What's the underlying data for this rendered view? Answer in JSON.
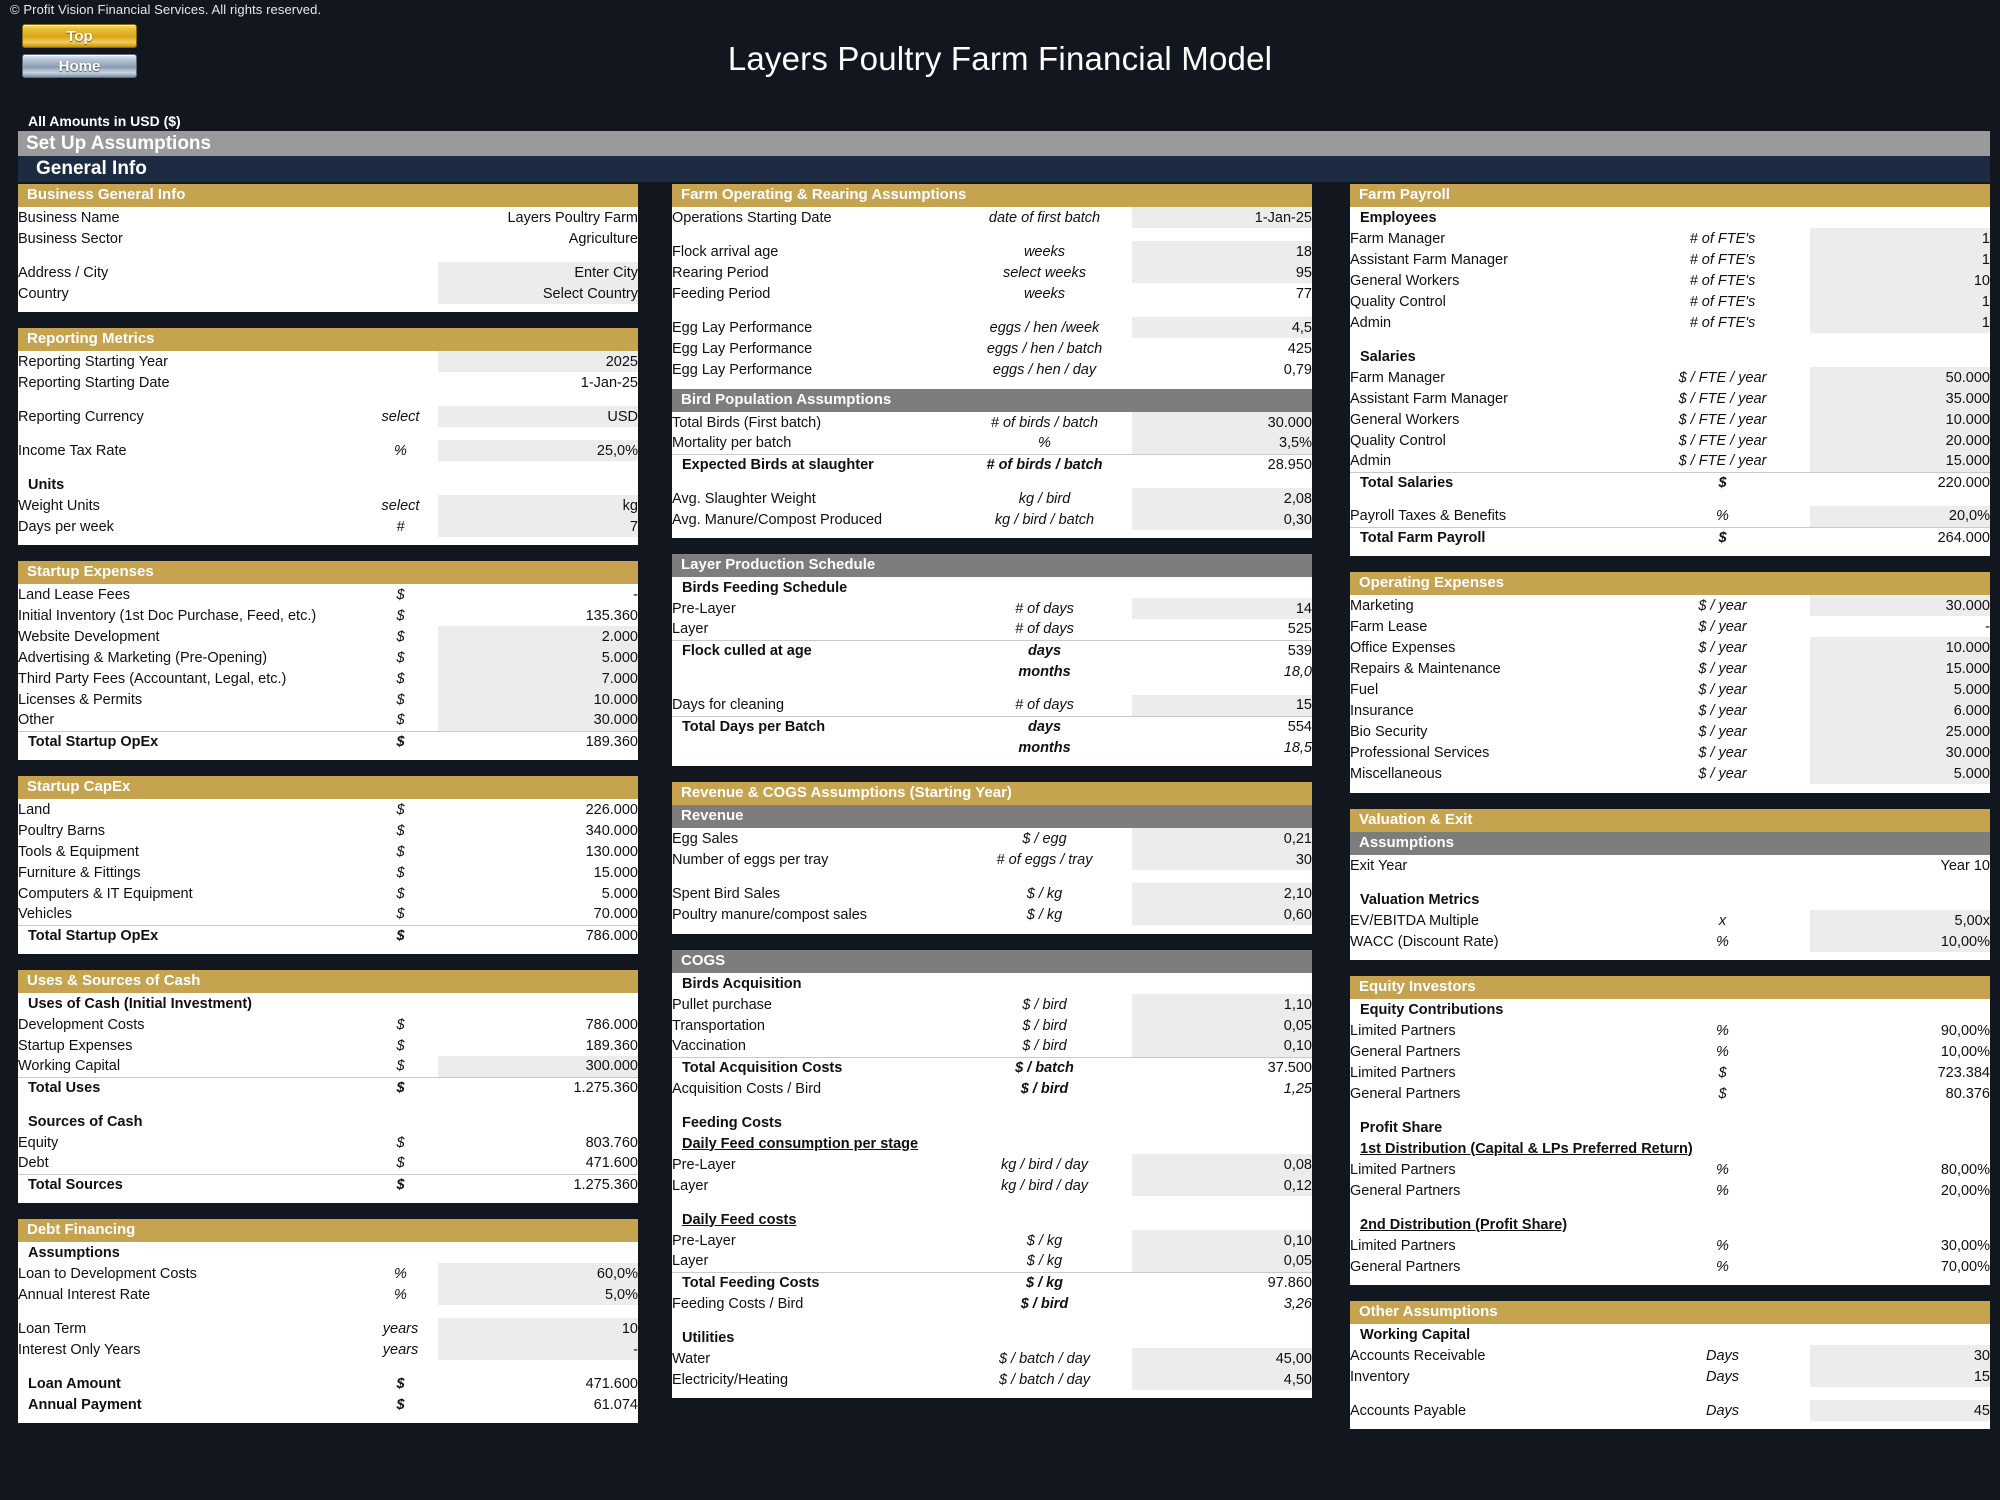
{
  "header": {
    "copyright": "© Profit Vision Financial Services. All rights reserved.",
    "top_button": "Top",
    "home_button": "Home",
    "title": "Layers Poultry Farm Financial Model",
    "amounts_note": "All Amounts in  USD ($)",
    "setup_bar": "Set Up Assumptions",
    "general_bar": "General Info"
  },
  "colors": {
    "gold": "#C6A44F",
    "grey_header": "#7D7D7D",
    "navy": "#1D2B42",
    "input_blue": "#1A2F9E",
    "green": "#1A7A4A",
    "teal": "#1F7F8C"
  },
  "business_general_info": {
    "title": "Business General Info",
    "rows": [
      {
        "label": "Business Name",
        "unit": "",
        "value": "Layers Poultry Farm",
        "style": "cal"
      },
      {
        "label": "Business Sector",
        "unit": "",
        "value": "Agriculture",
        "style": "cal"
      },
      {
        "label": "Address / City",
        "unit": "",
        "value": "Enter City",
        "style": "in"
      },
      {
        "label": "Country",
        "unit": "",
        "value": "Select Country",
        "style": "in"
      }
    ]
  },
  "reporting_metrics": {
    "title": "Reporting Metrics",
    "rows": [
      {
        "label": "Reporting Starting Year",
        "unit": "",
        "value": "2025",
        "style": "in"
      },
      {
        "label": "Reporting Starting Date",
        "unit": "",
        "value": "1-Jan-25",
        "style": "cal"
      },
      {
        "label": "Reporting Currency",
        "unit": "select",
        "value": "USD",
        "style": "in"
      },
      {
        "label": "Income Tax Rate",
        "unit": "%",
        "value": "25,0%",
        "style": "in"
      }
    ],
    "units_title": "Units",
    "units_rows": [
      {
        "label": "Weight Units",
        "unit": "select",
        "value": "kg",
        "style": "in"
      },
      {
        "label": "Days per week",
        "unit": "#",
        "value": "7",
        "style": "in"
      }
    ]
  },
  "startup_expenses": {
    "title": "Startup Expenses",
    "rows": [
      {
        "label": "Land Lease Fees",
        "unit": "$",
        "value": "-",
        "style": "cal"
      },
      {
        "label": "Initial Inventory (1st Doc Purchase, Feed, etc.)",
        "unit": "$",
        "value": "135.360",
        "style": "cal"
      },
      {
        "label": "Website Development",
        "unit": "$",
        "value": "2.000",
        "style": "in"
      },
      {
        "label": "Advertising & Marketing (Pre-Opening)",
        "unit": "$",
        "value": "5.000",
        "style": "in"
      },
      {
        "label": "Third Party Fees (Accountant, Legal, etc.)",
        "unit": "$",
        "value": "7.000",
        "style": "in"
      },
      {
        "label": "Licenses & Permits",
        "unit": "$",
        "value": "10.000",
        "style": "in"
      },
      {
        "label": "Other",
        "unit": "$",
        "value": "30.000",
        "style": "in"
      }
    ],
    "total": {
      "label": "Total Startup OpEx",
      "unit": "$",
      "value": "189.360"
    }
  },
  "startup_capex": {
    "title": "Startup CapEx",
    "rows": [
      {
        "label": "Land",
        "unit": "$",
        "value": "226.000",
        "style": "grn"
      },
      {
        "label": "Poultry Barns",
        "unit": "$",
        "value": "340.000",
        "style": "grn"
      },
      {
        "label": "Tools & Equipment",
        "unit": "$",
        "value": "130.000",
        "style": "grn"
      },
      {
        "label": "Furniture & Fittings",
        "unit": "$",
        "value": "15.000",
        "style": "grn"
      },
      {
        "label": "Computers & IT Equipment",
        "unit": "$",
        "value": "5.000",
        "style": "grn"
      },
      {
        "label": "Vehicles",
        "unit": "$",
        "value": "70.000",
        "style": "grn"
      }
    ],
    "total": {
      "label": "Total Startup OpEx",
      "unit": "$",
      "value": "786.000"
    }
  },
  "uses_sources": {
    "title": "Uses & Sources of Cash",
    "uses_heading": "Uses of Cash (Initial Investment)",
    "uses_rows": [
      {
        "label": "Development Costs",
        "unit": "$",
        "value": "786.000",
        "style": "cal"
      },
      {
        "label": "Startup Expenses",
        "unit": "$",
        "value": "189.360",
        "style": "cal"
      },
      {
        "label": "Working Capital",
        "unit": "$",
        "value": "300.000",
        "style": "in"
      }
    ],
    "uses_total": {
      "label": "Total Uses",
      "unit": "$",
      "value": "1.275.360"
    },
    "sources_heading": "Sources of Cash",
    "sources_rows": [
      {
        "label": "Equity",
        "unit": "$",
        "value": "803.760",
        "style": "cal"
      },
      {
        "label": "Debt",
        "unit": "$",
        "value": "471.600",
        "style": "cal"
      }
    ],
    "sources_total": {
      "label": "Total Sources",
      "unit": "$",
      "value": "1.275.360"
    }
  },
  "debt_financing": {
    "title": "Debt Financing",
    "assumptions_heading": "Assumptions",
    "rows": [
      {
        "label": "Loan to Development Costs",
        "unit": "%",
        "value": "60,0%",
        "style": "in"
      },
      {
        "label": "Annual Interest Rate",
        "unit": "%",
        "value": "5,0%",
        "style": "in"
      },
      {
        "label": "Loan Term",
        "unit": "years",
        "value": "10",
        "style": "in"
      },
      {
        "label": "Interest Only Years",
        "unit": "years",
        "value": "-",
        "style": "in"
      }
    ],
    "totals": [
      {
        "label": "Loan Amount",
        "unit": "$",
        "value": "471.600"
      },
      {
        "label": "Annual Payment",
        "unit": "$",
        "value": "61.074"
      }
    ]
  },
  "farm_operating": {
    "title": "Farm Operating & Rearing Assumptions",
    "rows_a": [
      {
        "label": "Operations Starting Date",
        "unit": "date of first batch",
        "value": "1-Jan-25",
        "style": "in"
      }
    ],
    "rows_b": [
      {
        "label": "Flock arrival age",
        "unit": "weeks",
        "value": "18",
        "style": "in"
      },
      {
        "label": "Rearing Period",
        "unit": "select weeks",
        "value": "95",
        "style": "in"
      },
      {
        "label": "Feeding Period",
        "unit": "weeks",
        "value": "77",
        "style": "cal"
      }
    ],
    "rows_c": [
      {
        "label": "Egg Lay Performance",
        "unit": "eggs / hen /week",
        "value": "4,5",
        "style": "in"
      },
      {
        "label": "Egg Lay Performance",
        "unit": "eggs / hen / batch",
        "value": "425",
        "style": "cal"
      },
      {
        "label": "Egg Lay Performance",
        "unit": "eggs / hen / day",
        "value": "0,79",
        "style": "cal"
      }
    ]
  },
  "bird_population": {
    "title": "Bird Population Assumptions",
    "rows": [
      {
        "label": "Total Birds (First batch)",
        "unit": "# of birds / batch",
        "value": "30.000",
        "style": "in"
      },
      {
        "label": "Mortality per batch",
        "unit": "%",
        "value": "3,5%",
        "style": "in"
      }
    ],
    "total": {
      "label": "Expected Birds at slaughter",
      "unit": "# of birds / batch",
      "value": "28.950"
    },
    "rows_after": [
      {
        "label": "Avg. Slaughter Weight",
        "unit": "kg / bird",
        "value": "2,08",
        "style": "in"
      },
      {
        "label": "Avg. Manure/Compost Produced",
        "unit": "kg / bird / batch",
        "value": "0,30",
        "style": "in"
      }
    ]
  },
  "layer_schedule": {
    "title": "Layer Production Schedule",
    "feeding_heading": "Birds Feeding Schedule",
    "rows": [
      {
        "label": "Pre-Layer",
        "unit": "# of days",
        "value": "14",
        "style": "in"
      },
      {
        "label": "Layer",
        "unit": "# of days",
        "value": "525",
        "style": "cal"
      }
    ],
    "culled": {
      "label": "Flock culled at age",
      "unit": "days",
      "value": "539"
    },
    "culled_months": {
      "label": "",
      "unit": "months",
      "value": "18,0"
    },
    "cleaning": {
      "label": "Days for cleaning",
      "unit": "# of days",
      "value": "15",
      "style": "in"
    },
    "total_days": {
      "label": "Total Days per Batch",
      "unit": "days",
      "value": "554"
    },
    "total_months": {
      "label": "",
      "unit": "months",
      "value": "18,5"
    }
  },
  "revenue_cogs": {
    "title": "Revenue & COGS Assumptions (Starting Year)",
    "revenue_heading": "Revenue",
    "revenue_rows_a": [
      {
        "label": "Egg Sales",
        "unit": "$ / egg",
        "value": "0,21",
        "style": "in"
      },
      {
        "label": "Number of eggs per tray",
        "unit": "# of eggs / tray",
        "value": "30",
        "style": "in"
      }
    ],
    "revenue_rows_b": [
      {
        "label": "Spent Bird Sales",
        "unit": "$ / kg",
        "value": "2,10",
        "style": "in"
      },
      {
        "label": "Poultry manure/compost sales",
        "unit": "$ / kg",
        "value": "0,60",
        "style": "in"
      }
    ],
    "cogs_heading": "COGS",
    "acq_heading": "Birds Acquisition",
    "acq_rows": [
      {
        "label": "Pullet purchase",
        "unit": "$ / bird",
        "value": "1,10",
        "style": "in"
      },
      {
        "label": "Transportation",
        "unit": "$ / bird",
        "value": "0,05",
        "style": "in"
      },
      {
        "label": "Vaccination",
        "unit": "$ / bird",
        "value": "0,10",
        "style": "in"
      }
    ],
    "acq_total": {
      "label": "Total Acquisition Costs",
      "unit": "$ / batch",
      "value": "37.500"
    },
    "acq_per_bird": {
      "label": "Acquisition Costs / Bird",
      "unit": "$ / bird",
      "value": "1,25"
    },
    "feeding_heading": "Feeding Costs",
    "daily_consumption_heading": "Daily Feed consumption per stage",
    "daily_consumption_rows": [
      {
        "label": "Pre-Layer",
        "unit": "kg / bird / day",
        "value": "0,08",
        "style": "in"
      },
      {
        "label": "Layer",
        "unit": "kg / bird / day",
        "value": "0,12",
        "style": "in"
      }
    ],
    "daily_costs_heading": "Daily Feed costs",
    "daily_costs_rows": [
      {
        "label": "Pre-Layer",
        "unit": "$ / kg",
        "value": "0,10",
        "style": "in"
      },
      {
        "label": "Layer",
        "unit": "$ / kg",
        "value": "0,05",
        "style": "in"
      }
    ],
    "feeding_total": {
      "label": "Total Feeding Costs",
      "unit": "$ / kg",
      "value": "97.860"
    },
    "feeding_per_bird": {
      "label": "Feeding Costs / Bird",
      "unit": "$ / bird",
      "value": "3,26"
    },
    "utilities_heading": "Utilities",
    "utilities_rows": [
      {
        "label": "Water",
        "unit": "$ / batch / day",
        "value": "45,00",
        "style": "in"
      },
      {
        "label": "Electricity/Heating",
        "unit": "$ / batch / day",
        "value": "4,50",
        "style": "in"
      }
    ]
  },
  "farm_payroll": {
    "title": "Farm Payroll",
    "employees_heading": "Employees",
    "employees": [
      {
        "label": "Farm Manager",
        "unit": "# of FTE's",
        "value": "1",
        "style": "in"
      },
      {
        "label": "Assistant Farm Manager",
        "unit": "# of FTE's",
        "value": "1",
        "style": "in"
      },
      {
        "label": "General Workers",
        "unit": "# of FTE's",
        "value": "10",
        "style": "in"
      },
      {
        "label": "Quality Control",
        "unit": "# of FTE's",
        "value": "1",
        "style": "in"
      },
      {
        "label": "Admin",
        "unit": "# of FTE's",
        "value": "1",
        "style": "in"
      }
    ],
    "salaries_heading": "Salaries",
    "salaries": [
      {
        "label": "Farm Manager",
        "unit": "$ / FTE / year",
        "value": "50.000",
        "style": "in"
      },
      {
        "label": "Assistant Farm Manager",
        "unit": "$ / FTE / year",
        "value": "35.000",
        "style": "in"
      },
      {
        "label": "General Workers",
        "unit": "$ / FTE / year",
        "value": "10.000",
        "style": "in"
      },
      {
        "label": "Quality Control",
        "unit": "$ / FTE / year",
        "value": "20.000",
        "style": "in"
      },
      {
        "label": "Admin",
        "unit": "$ / FTE / year",
        "value": "15.000",
        "style": "in"
      }
    ],
    "total_salaries": {
      "label": "Total Salaries",
      "unit": "$",
      "value": "220.000"
    },
    "payroll_taxes": {
      "label": "Payroll Taxes & Benefits",
      "unit": "%",
      "value": "20,0%",
      "style": "in"
    },
    "total_payroll": {
      "label": "Total Farm Payroll",
      "unit": "$",
      "value": "264.000"
    }
  },
  "operating_expenses": {
    "title": "Operating Expenses",
    "rows": [
      {
        "label": "Marketing",
        "unit": "$ / year",
        "value": "30.000",
        "style": "in"
      },
      {
        "label": "Farm Lease",
        "unit": "$ / year",
        "value": "-",
        "style": "cal"
      },
      {
        "label": "Office Expenses",
        "unit": "$ / year",
        "value": "10.000",
        "style": "in"
      },
      {
        "label": "Repairs & Maintenance",
        "unit": "$ / year",
        "value": "15.000",
        "style": "in"
      },
      {
        "label": "Fuel",
        "unit": "$ / year",
        "value": "5.000",
        "style": "in"
      },
      {
        "label": "Insurance",
        "unit": "$ / year",
        "value": "6.000",
        "style": "in"
      },
      {
        "label": "Bio Security",
        "unit": "$ / year",
        "value": "25.000",
        "style": "in"
      },
      {
        "label": "Professional Services",
        "unit": "$ / year",
        "value": "30.000",
        "style": "in"
      },
      {
        "label": "Miscellaneous",
        "unit": "$ / year",
        "value": "5.000",
        "style": "in"
      }
    ]
  },
  "valuation_exit": {
    "title": "Valuation & Exit",
    "assumptions_heading": "Assumptions",
    "exit_year": {
      "label": "Exit Year",
      "unit": "",
      "value": "Year 10"
    },
    "metrics_heading": "Valuation Metrics",
    "metrics": [
      {
        "label": "EV/EBITDA Multiple",
        "unit": "x",
        "value": "5,00x",
        "style": "in"
      },
      {
        "label": "WACC (Discount Rate)",
        "unit": "%",
        "value": "10,00%",
        "style": "in"
      }
    ]
  },
  "equity_investors": {
    "title": "Equity Investors",
    "contributions_heading": "Equity Contributions",
    "contributions": [
      {
        "label": "Limited Partners",
        "unit": "%",
        "value": "90,00%",
        "style": "grn"
      },
      {
        "label": "General Partners",
        "unit": "%",
        "value": "10,00%",
        "style": "grn"
      },
      {
        "label": "Limited Partners",
        "unit": "$",
        "value": "723.384",
        "style": "cal"
      },
      {
        "label": "General Partners",
        "unit": "$",
        "value": "80.376",
        "style": "cal"
      }
    ],
    "profit_share_heading": "Profit Share",
    "dist1_heading": "1st Distribution (Capital & LPs Preferred Return)",
    "dist1": [
      {
        "label": "Limited Partners",
        "unit": "%",
        "value": "80,00%",
        "style": "grn"
      },
      {
        "label": "General Partners",
        "unit": "%",
        "value": "20,00%",
        "style": "grn"
      }
    ],
    "dist2_heading": "2nd Distribution (Profit Share)",
    "dist2": [
      {
        "label": "Limited Partners",
        "unit": "%",
        "value": "30,00%",
        "style": "grn"
      },
      {
        "label": "General Partners",
        "unit": "%",
        "value": "70,00%",
        "style": "grn"
      }
    ]
  },
  "other_assumptions": {
    "title": "Other Assumptions",
    "working_capital_heading": "Working Capital",
    "rows_a": [
      {
        "label": "Accounts Receivable",
        "unit": "Days",
        "value": "30",
        "style": "in"
      },
      {
        "label": "Inventory",
        "unit": "Days",
        "value": "15",
        "style": "in"
      }
    ],
    "rows_b": [
      {
        "label": "Accounts Payable",
        "unit": "Days",
        "value": "45",
        "style": "in"
      }
    ]
  }
}
